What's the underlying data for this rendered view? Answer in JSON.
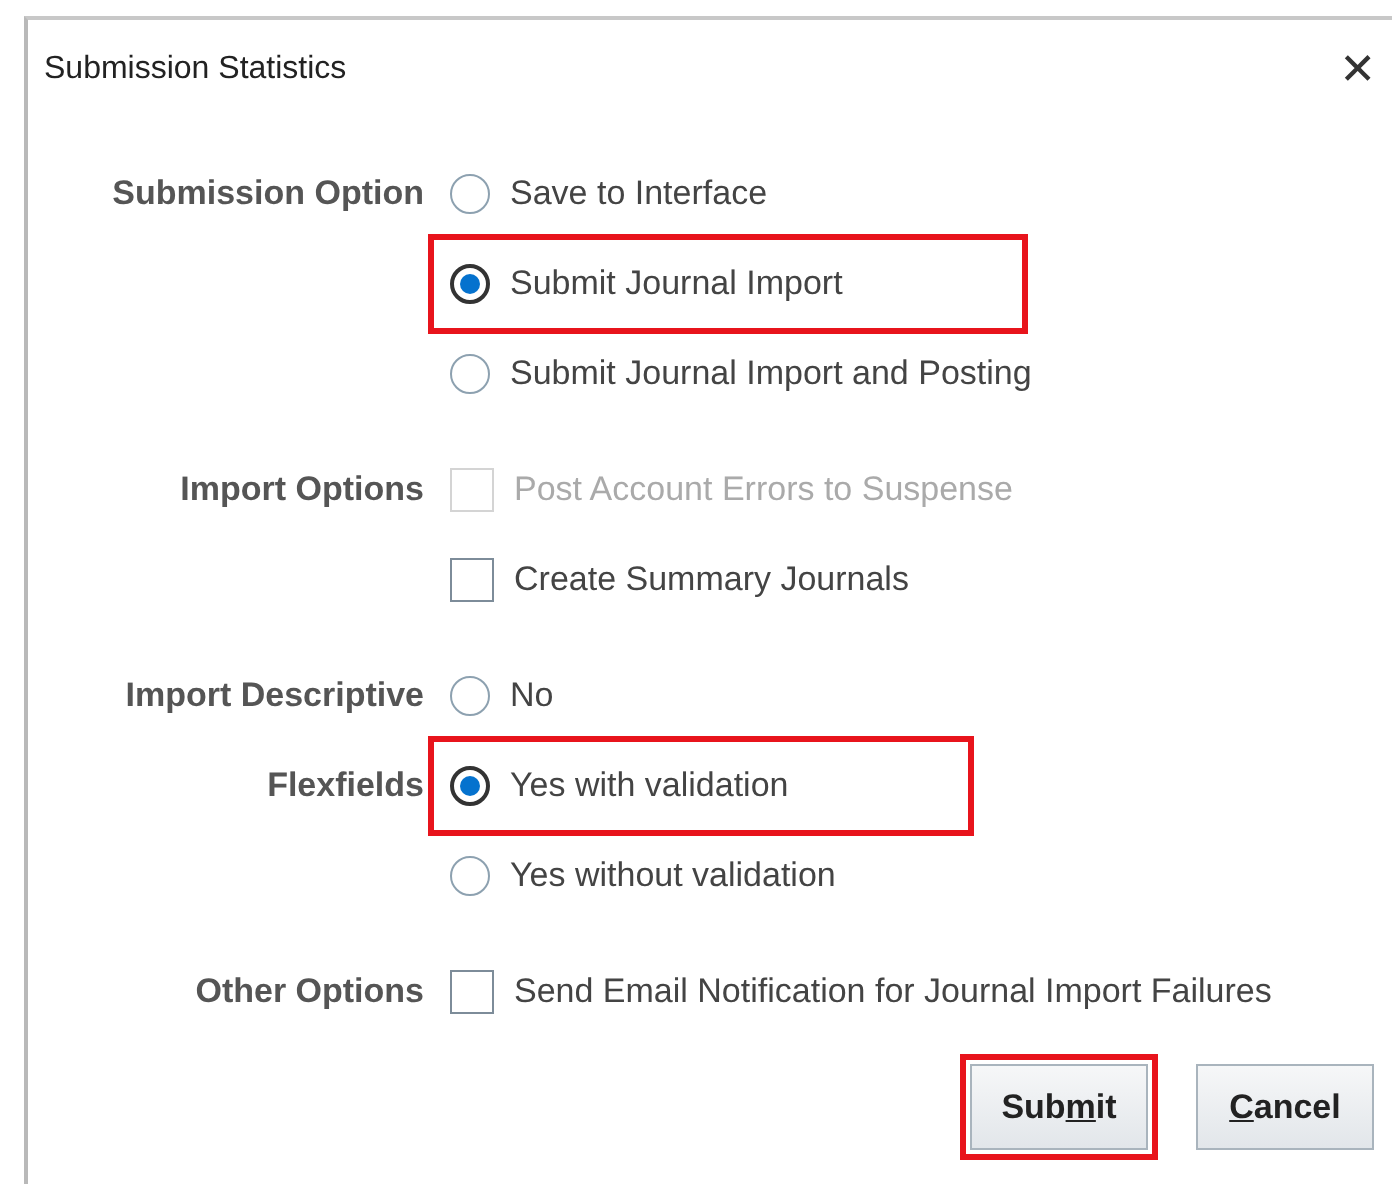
{
  "dialog": {
    "title": "Submission Statistics",
    "close_icon": "✕"
  },
  "sections": [
    {
      "rows": [
        {
          "label": "Submission Option",
          "kind": "radio",
          "text": "Save to Interface",
          "selected": false,
          "disabled": false,
          "highlighted": false
        },
        {
          "kind": "radio",
          "text": "Submit Journal Import",
          "selected": true,
          "disabled": false,
          "highlighted": true
        },
        {
          "kind": "radio",
          "text": "Submit Journal Import and Posting",
          "selected": false,
          "disabled": false,
          "highlighted": false
        }
      ]
    },
    {
      "rows": [
        {
          "label": "Import Options",
          "kind": "checkbox",
          "text": "Post Account Errors to Suspense",
          "checked": false,
          "disabled": true,
          "highlighted": false
        },
        {
          "kind": "checkbox",
          "text": "Create Summary Journals",
          "checked": false,
          "disabled": false,
          "highlighted": false
        }
      ]
    },
    {
      "rows": [
        {
          "label": "Import Descriptive",
          "kind": "radio",
          "text": "No",
          "selected": false,
          "disabled": false,
          "highlighted": false
        },
        {
          "label": "Flexfields",
          "kind": "radio",
          "text": "Yes with validation",
          "selected": true,
          "disabled": false,
          "highlighted": true
        },
        {
          "kind": "radio",
          "text": "Yes without validation",
          "selected": false,
          "disabled": false,
          "highlighted": false
        }
      ]
    },
    {
      "rows": [
        {
          "label": "Other Options",
          "kind": "checkbox",
          "text": "Send Email Notification for Journal Import Failures",
          "checked": false,
          "disabled": false,
          "highlighted": false
        }
      ]
    }
  ],
  "buttons": [
    {
      "parts": [
        {
          "text": "Sub",
          "underlined": false
        },
        {
          "text": "m",
          "underlined": true
        },
        {
          "text": "it",
          "underlined": false
        }
      ],
      "bold": true,
      "highlighted": true
    },
    {
      "parts": [
        {
          "text": "C",
          "underlined": true
        },
        {
          "text": "ancel",
          "underlined": false
        }
      ],
      "bold": true,
      "highlighted": false
    }
  ]
}
